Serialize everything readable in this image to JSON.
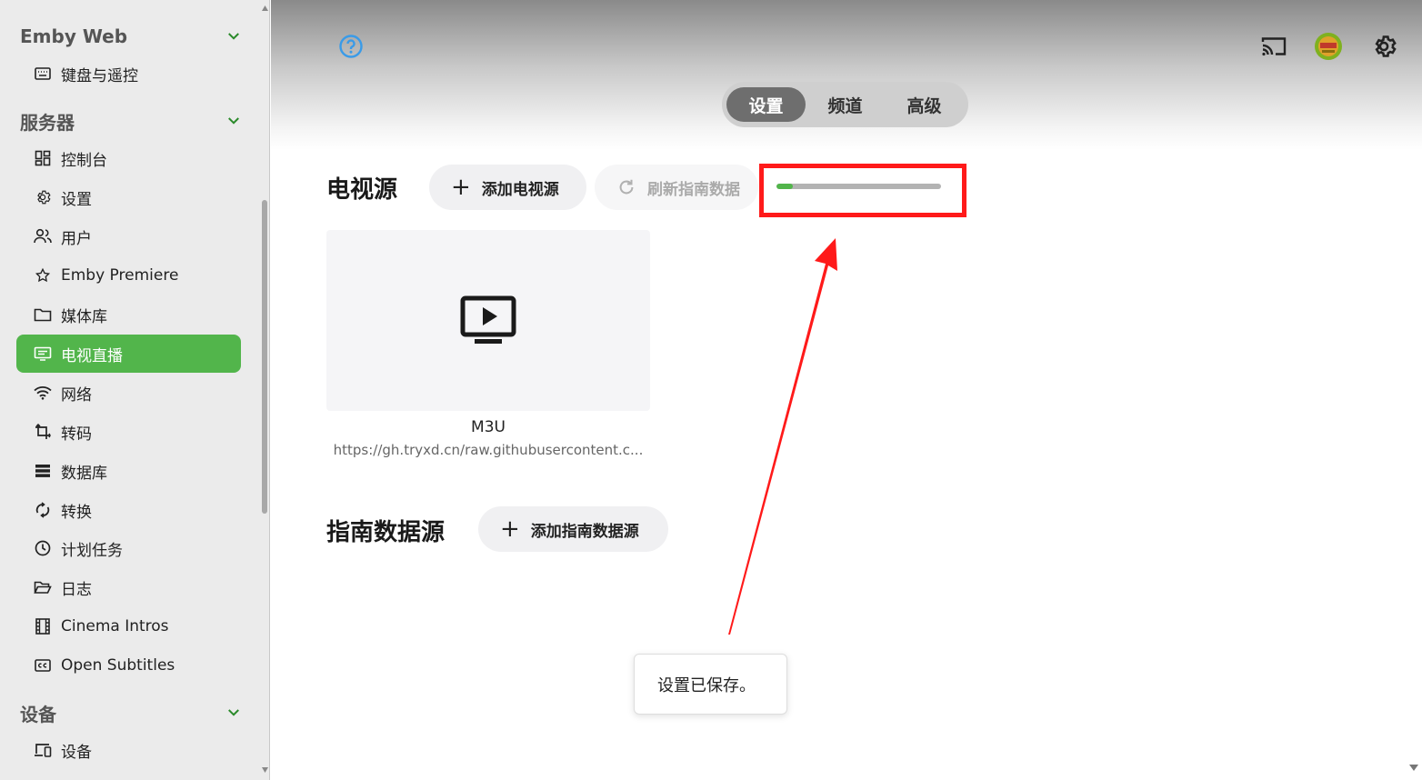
{
  "sidebar": {
    "sections": [
      {
        "title": "Emby Web"
      },
      {
        "title": "服务器"
      },
      {
        "title": "设备"
      }
    ],
    "items": [
      {
        "label": "键盘与遥控",
        "icon": "keyboard-icon"
      },
      {
        "label": "控制台",
        "icon": "dashboard-icon"
      },
      {
        "label": "设置",
        "icon": "gear-icon"
      },
      {
        "label": "用户",
        "icon": "users-icon"
      },
      {
        "label": "Emby Premiere",
        "icon": "star-icon"
      },
      {
        "label": "媒体库",
        "icon": "folder-icon"
      },
      {
        "label": "电视直播",
        "icon": "live-tv-icon"
      },
      {
        "label": "网络",
        "icon": "wifi-icon"
      },
      {
        "label": "转码",
        "icon": "transcode-icon"
      },
      {
        "label": "数据库",
        "icon": "database-icon"
      },
      {
        "label": "转换",
        "icon": "convert-icon"
      },
      {
        "label": "计划任务",
        "icon": "clock-icon"
      },
      {
        "label": "日志",
        "icon": "folder-open-icon"
      },
      {
        "label": "Cinema Intros",
        "icon": "film-icon"
      },
      {
        "label": "Open Subtitles",
        "icon": "subtitles-icon"
      },
      {
        "label": "设备",
        "icon": "devices-icon"
      }
    ],
    "active_item": "电视直播"
  },
  "header": {
    "help_icon": "help-icon",
    "cast_icon": "cast-icon",
    "avatar_icon": "avatar",
    "settings_icon": "gear-icon"
  },
  "tabs": [
    {
      "label": "设置",
      "active": true
    },
    {
      "label": "频道",
      "active": false
    },
    {
      "label": "高级",
      "active": false
    }
  ],
  "tv_sources": {
    "title": "电视源",
    "add_button": "添加电视源",
    "refresh_button": "刷新指南数据",
    "refresh_progress": 0.1
  },
  "source_card": {
    "name": "M3U",
    "url": "https://gh.tryxd.cn/raw.githubusercontent.c..."
  },
  "guide_sources": {
    "title": "指南数据源",
    "add_button": "添加指南数据源"
  },
  "toast": {
    "message": "设置已保存。"
  },
  "colors": {
    "accent": "#52b54b",
    "annotation": "#ff1a1a",
    "help": "#3a9be8"
  }
}
